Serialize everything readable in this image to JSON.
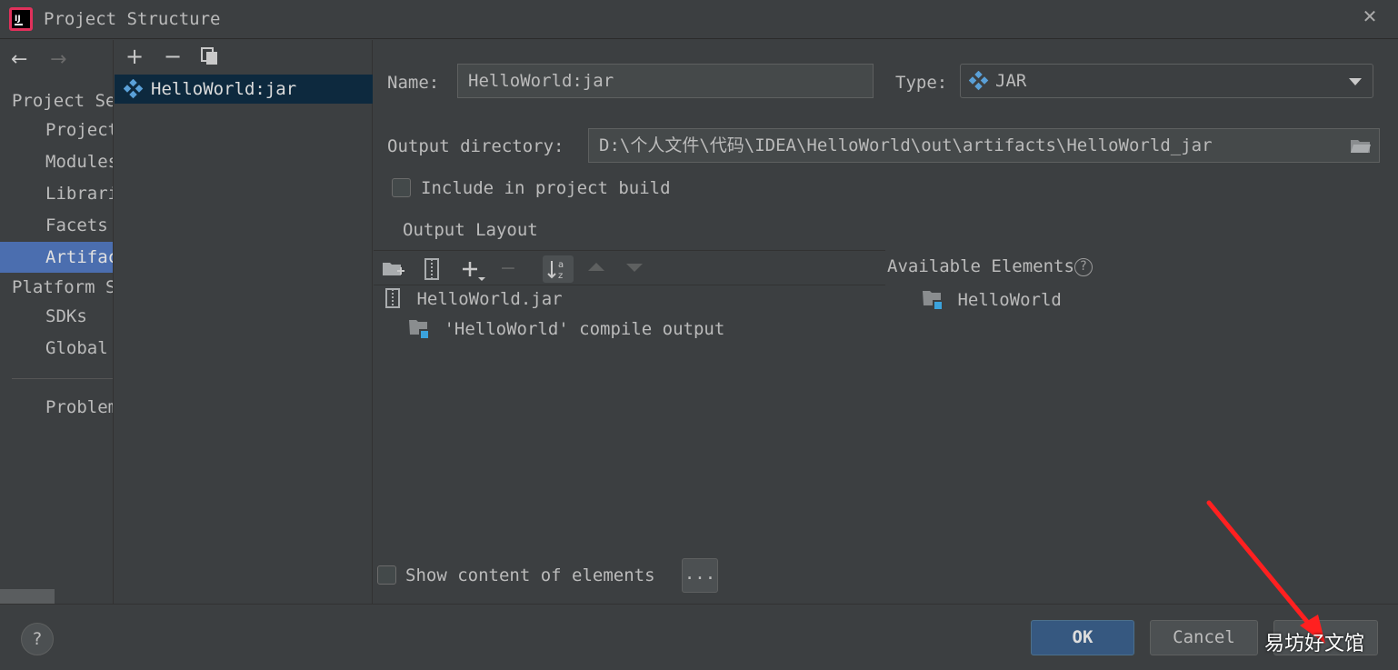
{
  "window": {
    "title": "Project Structure",
    "close_glyph": "✕"
  },
  "nav": {
    "back_glyph": "←",
    "forward_glyph": "→",
    "section_project": "Project Se",
    "items_project": [
      "Project",
      "Modules",
      "Librari",
      "Facets",
      "Artifac"
    ],
    "selected_item": "Artifac",
    "section_platform": "Platform S",
    "items_platform": [
      "SDKs",
      "Global"
    ],
    "problems": "Problem"
  },
  "artifact_list": {
    "toolbar": {
      "add": "+",
      "remove": "−",
      "copy_icon": "copy-icon"
    },
    "items": [
      {
        "label": "HelloWorld:jar"
      }
    ]
  },
  "detail": {
    "name_label": "Name:",
    "name_value": "HelloWorld:jar",
    "type_label": "Type:",
    "type_value": "JAR",
    "output_dir_label": "Output directory:",
    "output_dir_value": "D:\\个人文件\\代码\\IDEA\\HelloWorld\\out\\artifacts\\HelloWorld_jar",
    "include_label": "Include in project build",
    "include_checked": false,
    "output_layout_label": "Output Layout",
    "layout_tree": [
      {
        "label": "HelloWorld.jar",
        "icon": "jar-icon"
      },
      {
        "label": "'HelloWorld' compile output",
        "icon": "module-folder-icon"
      }
    ],
    "available_label": "Available Elements",
    "available_help": "?",
    "available_tree": [
      {
        "label": "HelloWorld",
        "icon": "module-folder-icon"
      }
    ],
    "show_content_label": "Show content of elements",
    "show_content_checked": false,
    "ellipsis_label": "..."
  },
  "footer": {
    "help": "?",
    "ok": "OK",
    "cancel": "Cancel"
  },
  "watermark": "易坊好文馆",
  "colors": {
    "background": "#3c3f41",
    "selection": "#4b6eaf",
    "list_selection": "#0d293e",
    "ok_button": "#365880",
    "artifact_icon": "#5aa0d8",
    "annotation_arrow": "#ff2020"
  }
}
